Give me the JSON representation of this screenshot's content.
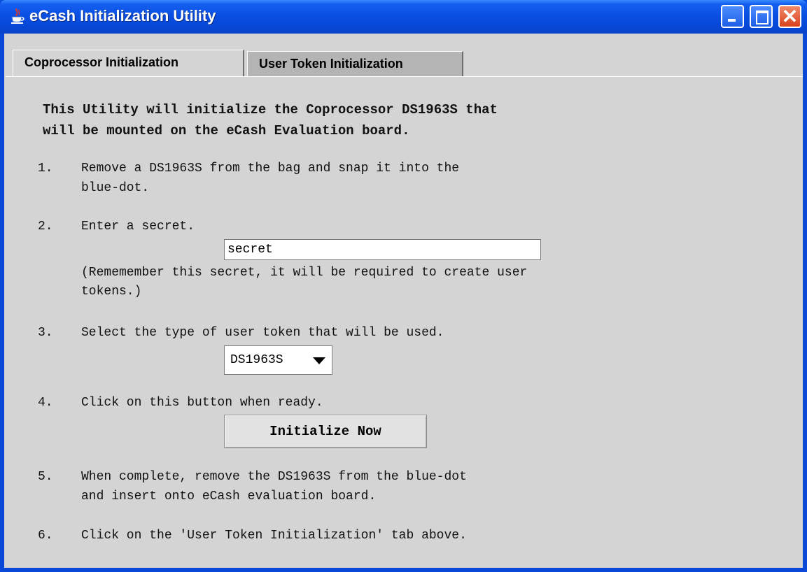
{
  "window": {
    "title": "eCash Initialization Utility"
  },
  "tabs": [
    {
      "label": "Coprocessor Initialization",
      "selected": true
    },
    {
      "label": "User Token Initialization",
      "selected": false
    }
  ],
  "intro": {
    "line1": "This Utility will initialize the Coprocessor DS1963S that",
    "line2": "will be mounted on the eCash Evaluation board."
  },
  "steps": {
    "s1": {
      "num": "1.",
      "line1": "Remove a DS1963S from the bag and snap it into the",
      "line2": "blue-dot."
    },
    "s2": {
      "num": "2.",
      "line1": "Enter a secret.",
      "note1": "(Rememember this secret, it will be required to create user",
      "note2": "tokens.)"
    },
    "s3": {
      "num": "3.",
      "line1": "Select the type of user token that will be used."
    },
    "s4": {
      "num": "4.",
      "line1": "Click on this button when ready."
    },
    "s5": {
      "num": "5.",
      "line1": "When complete, remove the DS1963S from the blue-dot",
      "line2": "and insert onto eCash evaluation board."
    },
    "s6": {
      "num": "6.",
      "line1": "Click on the 'User Token Initialization' tab above."
    }
  },
  "secret_input": {
    "value": "secret"
  },
  "token_type": {
    "selected": "DS1963S"
  },
  "initialize_button": {
    "label": "Initialize Now"
  },
  "icons": {
    "app": "java-cup-icon",
    "minimize": "minimize-icon",
    "maximize": "maximize-icon",
    "close": "close-icon",
    "dropdown": "chevron-down-icon"
  }
}
